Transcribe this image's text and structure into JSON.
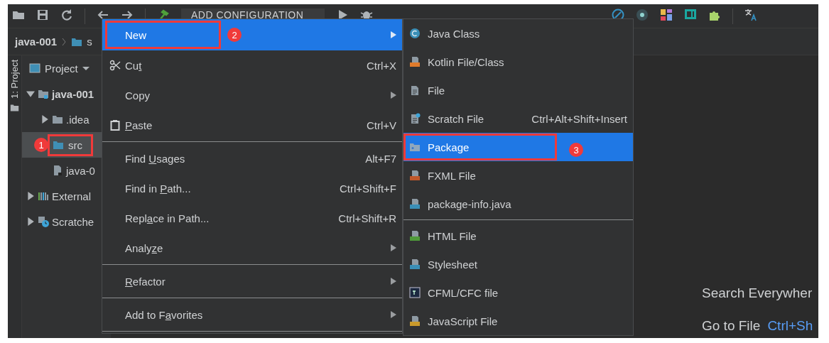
{
  "toolbar": {
    "run_configuration": "ADD CONFIGURATION"
  },
  "breadcrumb": [
    {
      "label": "java-001",
      "kind": "project"
    },
    {
      "label": "s",
      "kind": "folder"
    }
  ],
  "side_stripe": {
    "label": "1: Project"
  },
  "project_panel": {
    "title": "Project",
    "tree": [
      {
        "label": "java-001",
        "kind": "module",
        "expanded": true,
        "selected": false,
        "children": [
          {
            "label": ".idea",
            "kind": "folder",
            "expanded": false,
            "selected": false
          },
          {
            "label": "src",
            "kind": "source-folder",
            "selected": true,
            "callout": "1"
          },
          {
            "label": "java-0",
            "kind": "module-file",
            "selected": false
          }
        ]
      },
      {
        "label": "External",
        "kind": "libraries",
        "expanded": false,
        "selected": false
      },
      {
        "label": "Scratche",
        "kind": "scratches",
        "expanded": false,
        "selected": false
      }
    ]
  },
  "context_menu": {
    "items": [
      {
        "kind": "command",
        "label": "New",
        "submenu": true,
        "selected": true,
        "callout": "2"
      },
      {
        "kind": "scissors-command",
        "label": "Cu",
        "mnemonic": "t",
        "shortcut": "Ctrl+X",
        "selected": false
      },
      {
        "kind": "command",
        "label": "Copy",
        "submenu": true,
        "selected": false
      },
      {
        "kind": "clipboard-command",
        "mnemonic": "P",
        "label_end": "aste",
        "shortcut": "Ctrl+V",
        "selected": false
      },
      {
        "kind": "separator"
      },
      {
        "kind": "command",
        "label": "Find ",
        "mnemonic": "U",
        "label_end": "sages",
        "shortcut": "Alt+F7",
        "selected": false
      },
      {
        "kind": "command",
        "label": "Find in ",
        "mnemonic": "P",
        "label_end": "ath...",
        "shortcut": "Ctrl+Shift+F",
        "selected": false
      },
      {
        "kind": "command",
        "label": "Repl",
        "mnemonic": "a",
        "label_end": "ce in Path...",
        "shortcut": "Ctrl+Shift+R",
        "selected": false
      },
      {
        "kind": "command",
        "label": "Analy",
        "mnemonic": "z",
        "label_end": "e",
        "submenu": true,
        "selected": false
      },
      {
        "kind": "separator"
      },
      {
        "kind": "command",
        "mnemonic": "R",
        "label_end": "efactor",
        "submenu": true,
        "selected": false
      },
      {
        "kind": "separator"
      },
      {
        "kind": "command",
        "label": "Add to F",
        "mnemonic": "a",
        "label_end": "vorites",
        "submenu": true,
        "selected": false
      },
      {
        "kind": "separator"
      }
    ]
  },
  "new_submenu": {
    "items": [
      {
        "kind": "java-class",
        "label": "Java Class",
        "selected": false
      },
      {
        "kind": "kotlin",
        "label": "Kotlin File/Class",
        "selected": false
      },
      {
        "kind": "file",
        "label": "File",
        "selected": false
      },
      {
        "kind": "scratch",
        "label": "Scratch File",
        "shortcut": "Ctrl+Alt+Shift+Insert",
        "selected": false
      },
      {
        "kind": "package",
        "label": "Package",
        "selected": true,
        "callout": "3"
      },
      {
        "kind": "fxml",
        "label": "FXML File",
        "selected": false
      },
      {
        "kind": "java-file",
        "label": "package-info.java",
        "selected": false
      },
      {
        "kind": "separator"
      },
      {
        "kind": "html",
        "label": "HTML File",
        "selected": false
      },
      {
        "kind": "css",
        "label": "Stylesheet",
        "selected": false
      },
      {
        "kind": "cfml",
        "label": "CFML/CFC file",
        "selected": false
      },
      {
        "kind": "javascript",
        "label": "JavaScript File",
        "selected": false
      }
    ]
  },
  "editor_hints": [
    {
      "label": "Search Everywher"
    },
    {
      "label": "Go to File",
      "shortcut": "Ctrl+Sh"
    }
  ]
}
